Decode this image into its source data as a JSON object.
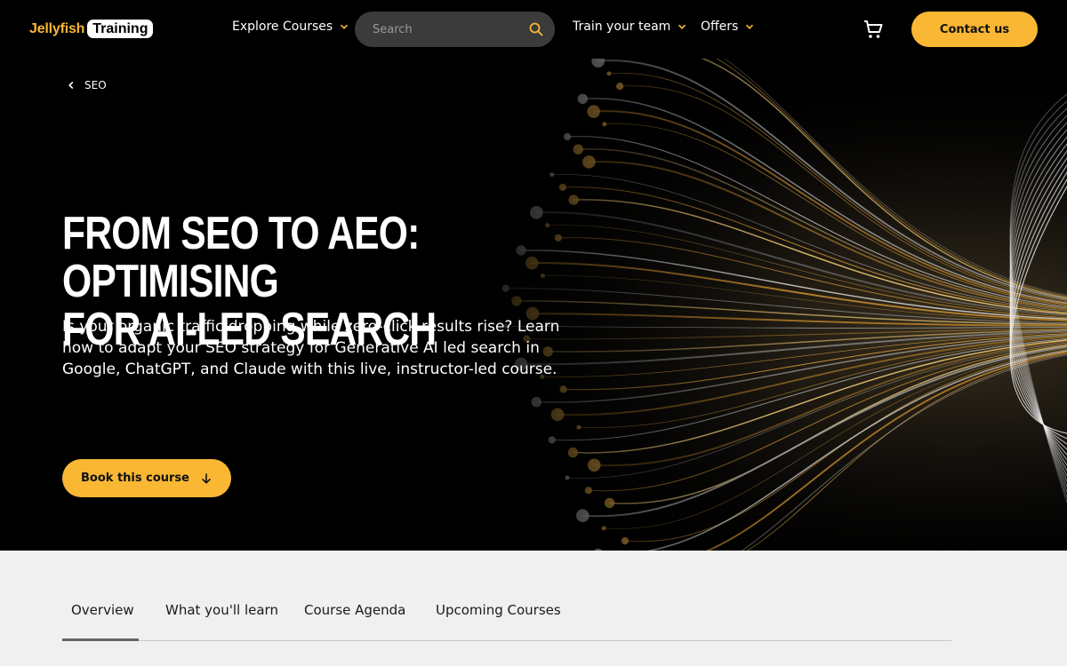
{
  "header": {
    "logo_primary": "Jellyfish",
    "logo_secondary": "Training",
    "nav": {
      "explore": "Explore Courses",
      "train": "Train your team",
      "offers": "Offers"
    },
    "search_placeholder": "Search",
    "contact_label": "Contact us"
  },
  "hero": {
    "breadcrumb": "SEO",
    "title_line1": "From SEO to AEO: Optimising",
    "title_line2": "for AI-led search",
    "subtitle": "Is your organic traffic dropping while zero-click results rise? Learn how to adapt your SEO strategy for Generative AI led search in Google, ChatGPT, and Claude with this live, instructor-led course.",
    "book_label": "Book this course"
  },
  "tabs": [
    {
      "label": "Overview",
      "active": true
    },
    {
      "label": "What you'll learn"
    },
    {
      "label": "Course Agenda"
    },
    {
      "label": "Upcoming Courses"
    }
  ],
  "colors": {
    "accent": "#f9b733",
    "background": "#000000",
    "tabs_background": "#f0f0f0"
  },
  "icons": {
    "nav_chevron": "chevron-down-icon",
    "search": "search-icon",
    "cart": "cart-icon",
    "breadcrumb": "chevron-left-icon",
    "book": "arrow-down-icon"
  }
}
